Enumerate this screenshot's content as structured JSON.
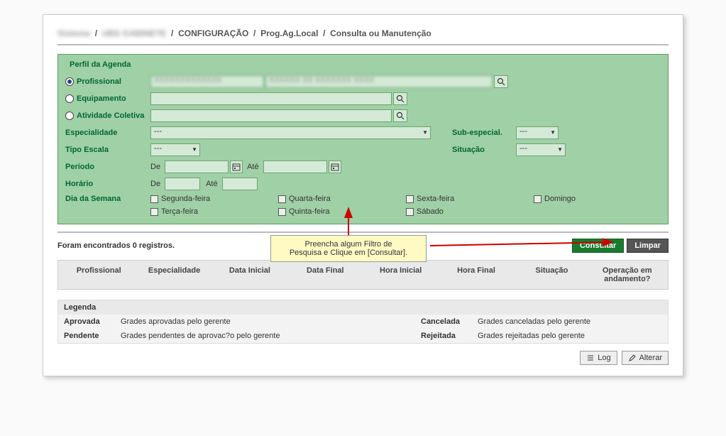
{
  "breadcrumb": {
    "blurred1": "Sistema",
    "blurred2": "UBS GABINETE",
    "part3": "CONFIGURAÇÃO",
    "part4": "Prog.Ag.Local",
    "part5": "Consulta ou Manutenção"
  },
  "panel": {
    "title": "Perfil da Agenda",
    "profissional_label": "Profissional",
    "profissional_val1": "XXXXXXXXXXXXX",
    "profissional_val2": "XXXXXX XX XXXXXXX XXXX",
    "equipamento_label": "Equipamento",
    "atividade_label": "Atividade Coletiva",
    "especialidade_label": "Especialidade",
    "especialidade_val": "---",
    "sub_especial_label": "Sub-especial.",
    "sub_especial_val": "---",
    "tipo_escala_label": "Tipo Escala",
    "tipo_escala_val": "---",
    "situacao_label": "Situação",
    "situacao_val": "---",
    "periodo_label": "Período",
    "de_label": "De",
    "ate_label": "Até",
    "horario_label": "Horário",
    "dia_semana_label": "Dia da Semana",
    "days": {
      "seg": "Segunda-feira",
      "ter": "Terça-feira",
      "qua": "Quarta-feira",
      "qui": "Quinta-feira",
      "sex": "Sexta-feira",
      "sab": "Sábado",
      "dom": "Domingo"
    }
  },
  "callout_line1": "Preencha algum Filtro de",
  "callout_line2": "Pesquisa e Clique em [Consultar].",
  "found_text": "Foram encontrados 0 registros.",
  "buttons": {
    "consultar": "Consultar",
    "limpar": "Limpar",
    "log": "Log",
    "alterar": "Alterar"
  },
  "columns": {
    "profissional": "Profissional",
    "especialidade": "Especialidade",
    "data_inicial": "Data Inicial",
    "data_final": "Data Final",
    "hora_inicial": "Hora Inicial",
    "hora_final": "Hora Final",
    "situacao": "Situação",
    "operacao": "Operação em andamento?"
  },
  "legend": {
    "title": "Legenda",
    "aprovada_k": "Aprovada",
    "aprovada_v": "Grades aprovadas pelo gerente",
    "cancelada_k": "Cancelada",
    "cancelada_v": "Grades canceladas pelo gerente",
    "pendente_k": "Pendente",
    "pendente_v": "Grades pendentes de aprovac?o pelo gerente",
    "rejeitada_k": "Rejeitada",
    "rejeitada_v": "Grades rejeitadas pelo gerente"
  }
}
